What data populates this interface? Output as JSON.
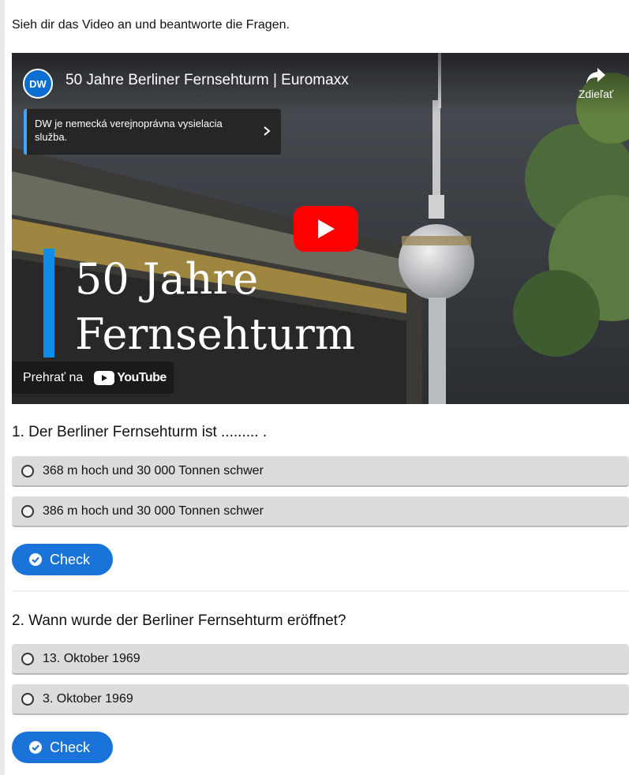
{
  "instruction": "Sieh dir das Video an und beantworte die Fragen.",
  "video": {
    "channel_logo_text": "DW",
    "title": "50 Jahre Berliner Fernsehturm | Euromaxx",
    "share_label": "Zdieľať",
    "info_card": "DW je nemecká verejnoprávna vysielacia služba.",
    "thumbnail_title_line1": "50 Jahre",
    "thumbnail_title_line2": "Fernsehturm",
    "watch_on_label": "Prehrať na",
    "youtube_label": "YouTube"
  },
  "questions": [
    {
      "text": "1. Der Berliner Fernsehturm ist ......... .",
      "options": [
        "368 m hoch und 30 000 Tonnen schwer",
        "386 m hoch und 30 000 Tonnen schwer"
      ],
      "check_label": "Check"
    },
    {
      "text": "2. Wann wurde der Berliner Fernsehturm eröffnet?",
      "options": [
        "13. Oktober 1969",
        "3. Oktober 1969"
      ],
      "check_label": "Check"
    }
  ],
  "colors": {
    "check_button": "#1a73d9",
    "option_background": "#dcdcdc",
    "play_button": "#ff0000",
    "accent_blue": "#0d8ee8"
  }
}
